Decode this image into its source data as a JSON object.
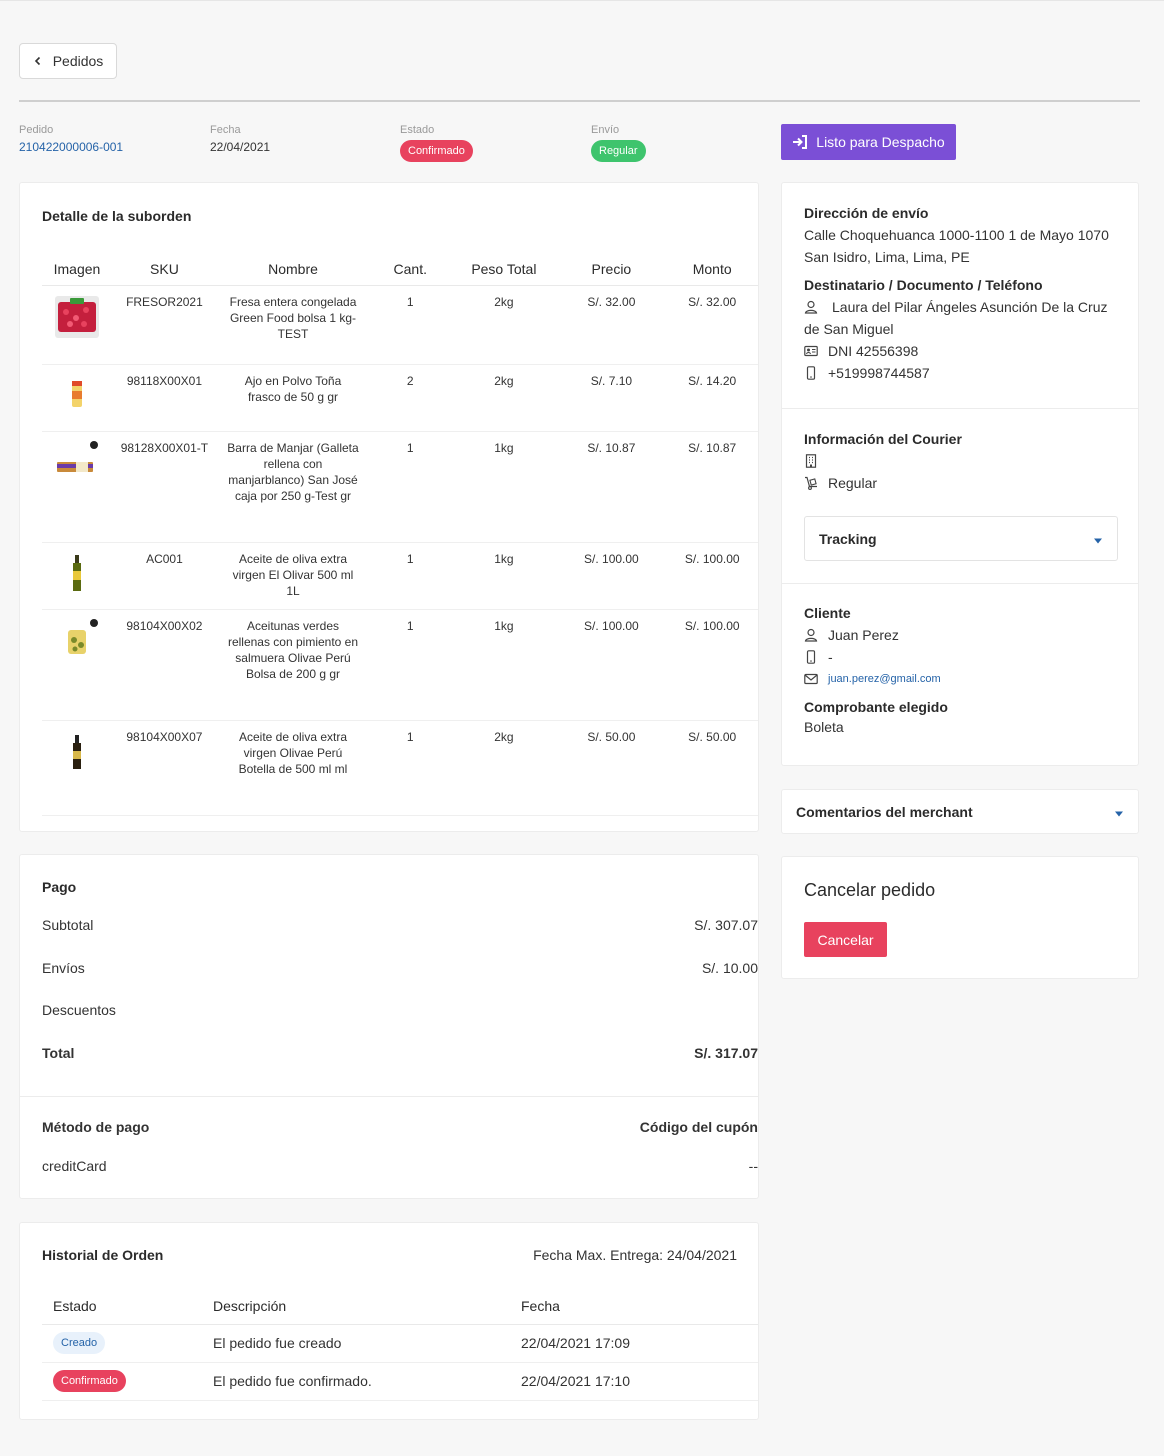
{
  "nav": {
    "back_label": "Pedidos"
  },
  "meta": {
    "pedido_label": "Pedido",
    "pedido_value": "210422000006-001",
    "fecha_label": "Fecha",
    "fecha_value": "22/04/2021",
    "estado_label": "Estado",
    "estado_value": "Confirmado",
    "envio_label": "Envío",
    "envio_value": "Regular"
  },
  "actions": {
    "dispatch_label": "Listo para Despacho"
  },
  "detail": {
    "title": "Detalle de la suborden",
    "columns": [
      "Imagen",
      "SKU",
      "Nombre",
      "Cant.",
      "Peso Total",
      "Precio",
      "Monto"
    ],
    "rows": [
      {
        "image": "frozen-strawberry-bag",
        "sku": "FRESOR2021",
        "name": "Fresa entera congelada Green Food bolsa 1 kg-TEST",
        "qty": "1",
        "weight": "2kg",
        "price": "S/. 32.00",
        "amount": "S/. 32.00"
      },
      {
        "image": "garlic-powder-jar",
        "sku": "98118X00X01",
        "name": "Ajo en Polvo Toña frasco de 50 g gr",
        "qty": "2",
        "weight": "2kg",
        "price": "S/. 7.10",
        "amount": "S/. 14.20"
      },
      {
        "image": "biscuit-box",
        "sku": "98128X00X01-T",
        "name": "Barra de Manjar (Galleta rellena con manjarblanco) San José caja por 250 g-Test gr",
        "qty": "1",
        "weight": "1kg",
        "price": "S/. 10.87",
        "amount": "S/. 10.87"
      },
      {
        "image": "olive-oil-bottle",
        "sku": "AC001",
        "name": "Aceite de oliva extra virgen El Olivar 500 ml 1L",
        "qty": "1",
        "weight": "1kg",
        "price": "S/. 100.00",
        "amount": "S/. 100.00"
      },
      {
        "image": "olives-bag",
        "sku": "98104X00X02",
        "name": "Aceitunas verdes rellenas con pimiento en salmuera Olivae Perú Bolsa de 200 g gr",
        "qty": "1",
        "weight": "1kg",
        "price": "S/. 100.00",
        "amount": "S/. 100.00"
      },
      {
        "image": "olive-oil-bottle-dark",
        "sku": "98104X00X07",
        "name": "Aceite de oliva extra virgen Olivae Perú Botella de 500 ml ml",
        "qty": "1",
        "weight": "2kg",
        "price": "S/. 50.00",
        "amount": "S/. 50.00"
      }
    ]
  },
  "payment": {
    "title": "Pago",
    "subtotal_label": "Subtotal",
    "subtotal_value": "S/. 307.07",
    "shipping_label": "Envíos",
    "shipping_value": "S/. 10.00",
    "discount_label": "Descuentos",
    "total_label": "Total",
    "total_value": "S/. 317.07",
    "method_label": "Método de pago",
    "coupon_label": "Código del cupón",
    "method_value": "creditCard",
    "coupon_value": "--"
  },
  "history": {
    "title": "Historial de Orden",
    "max_delivery": "Fecha Max. Entrega: 24/04/2021",
    "columns": [
      "Estado",
      "Descripción",
      "Fecha"
    ],
    "rows": [
      {
        "status": "Creado",
        "description": "El pedido fue creado",
        "date": "22/04/2021 17:09"
      },
      {
        "status": "Confirmado",
        "description": "El pedido fue confirmado.",
        "date": "22/04/2021 17:10"
      }
    ]
  },
  "shipping": {
    "address_label": "Dirección de envío",
    "address_line1": "Calle Choquehuanca 1000-1100 1 de Mayo 1070",
    "address_line2": "San Isidro, Lima, Lima, PE",
    "recipient_label": "Destinatario / Documento / Teléfono",
    "recipient_name": "Laura del Pilar Ángeles Asunción De la Cruz",
    "recipient_name_cont": "de San Miguel",
    "recipient_doc": "DNI 42556398",
    "recipient_phone": "+519998744587"
  },
  "courier": {
    "label": "Información del Courier",
    "service": "Regular",
    "tracking_label": "Tracking"
  },
  "client": {
    "label": "Cliente",
    "name": "Juan Perez",
    "phone": "-",
    "email": "juan.perez@gmail.com",
    "voucher_label": "Comprobante elegido",
    "voucher_value": "Boleta"
  },
  "merchant": {
    "comments_label": "Comentarios del merchant"
  },
  "cancel": {
    "title": "Cancelar pedido",
    "button_label": "Cancelar"
  },
  "colors": {
    "accent": "#7b4fd6",
    "danger": "#e8425e",
    "success": "#3ec46d",
    "link": "#2563a8"
  }
}
